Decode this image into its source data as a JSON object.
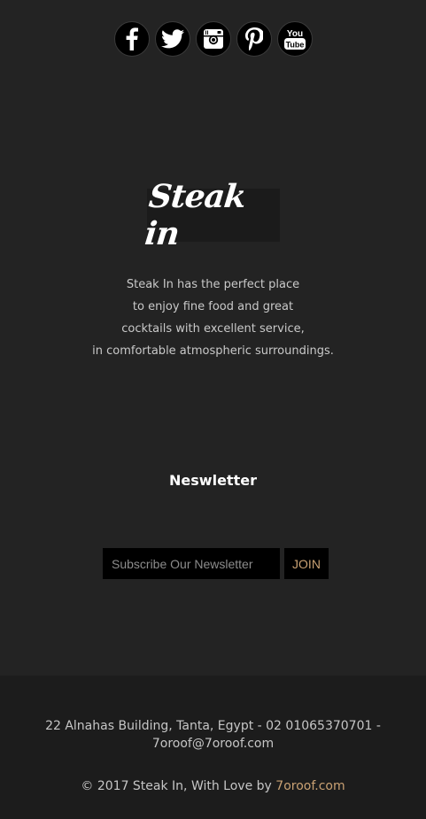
{
  "social": {
    "icons": [
      "facebook-icon",
      "twitter-icon",
      "instagram-icon",
      "pinterest-icon",
      "youtube-icon"
    ],
    "youtube_label_top": "You",
    "youtube_label_bottom": "Tube"
  },
  "logo": {
    "text": "Steak in"
  },
  "about": {
    "lines": [
      "Steak In has the perfect place",
      "to enjoy fine food and great",
      "cocktails with excellent service,",
      "in comfortable atmospheric surroundings."
    ]
  },
  "newsletter": {
    "title": "Neswletter",
    "placeholder": "Subscribe Our Newsletter",
    "value": "",
    "join_label": "JOIN"
  },
  "footer": {
    "address_line1": "22 Alnahas Building, Tanta, Egypt - 02 01065370701 -",
    "address_line2": "7oroof@7oroof.com",
    "copyright_prefix": "© 2017 Steak In, With Love by ",
    "copyright_link": "7oroof.com"
  },
  "colors": {
    "background": "#232323",
    "footer_background": "#1c1c1c",
    "accent": "#c9a173"
  }
}
